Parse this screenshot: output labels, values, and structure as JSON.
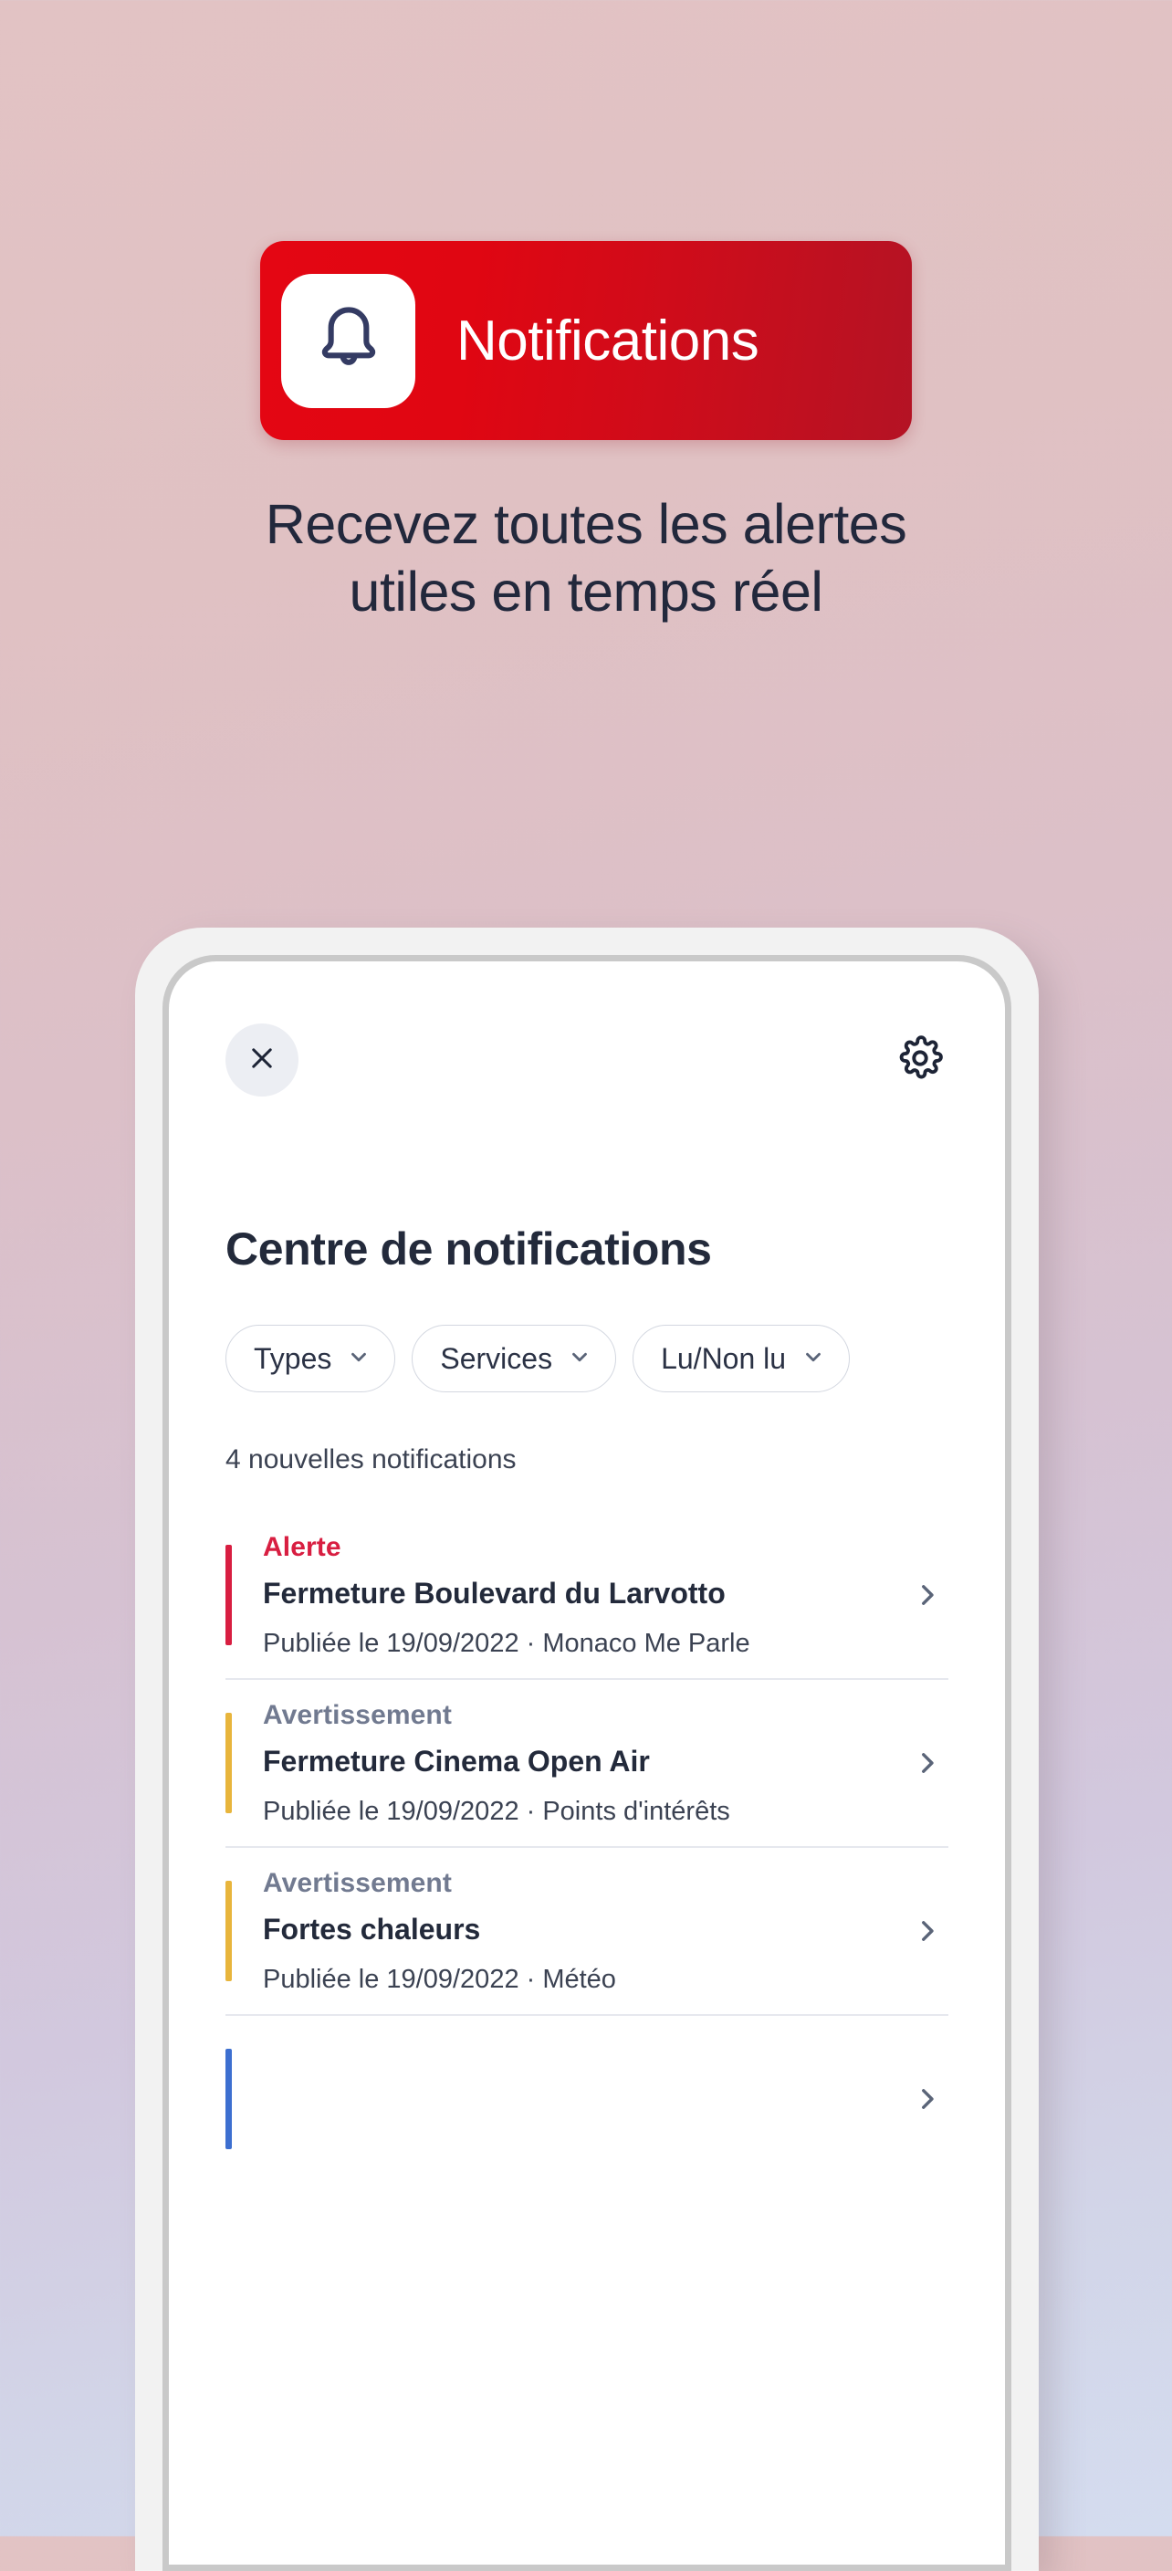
{
  "hero": {
    "badge_label": "Notifications",
    "badge_icon": "bell-icon",
    "badge_color": "#e40613",
    "headline_line1": "Recevez toutes les alertes",
    "headline_line2": "utiles en temps réel",
    "headline_color": "#22283c"
  },
  "app": {
    "topbar": {
      "close_icon": "close-icon",
      "settings_icon": "gear-icon"
    },
    "page_title": "Centre de notifications",
    "filters": [
      {
        "label": "Types",
        "icon": "chevron-down-icon"
      },
      {
        "label": "Services",
        "icon": "chevron-down-icon"
      },
      {
        "label": "Lu/Non lu",
        "icon": "chevron-down-icon"
      }
    ],
    "count_text": "4 nouvelles notifications",
    "notifications": [
      {
        "type": "Alerte",
        "type_color": "#d81e41",
        "bar_color": "#d81e41",
        "title": "Fermeture Boulevard du Larvotto",
        "meta": "Publiée le 19/09/2022 · Monaco Me Parle",
        "chevron_icon": "chevron-right-icon"
      },
      {
        "type": "Avertissement",
        "type_color": "#717a90",
        "bar_color": "#e8b53c",
        "title": "Fermeture Cinema Open Air",
        "meta": "Publiée le 19/09/2022 · Points d'intérêts",
        "chevron_icon": "chevron-right-icon"
      },
      {
        "type": "Avertissement",
        "type_color": "#717a90",
        "bar_color": "#e8b53c",
        "title": "Fortes chaleurs",
        "meta": "Publiée le 19/09/2022 · Météo",
        "chevron_icon": "chevron-right-icon"
      },
      {
        "type": "",
        "type_color": "#717a90",
        "bar_color": "#3d6fd0",
        "title": "",
        "meta": "",
        "chevron_icon": "chevron-right-icon"
      }
    ]
  }
}
